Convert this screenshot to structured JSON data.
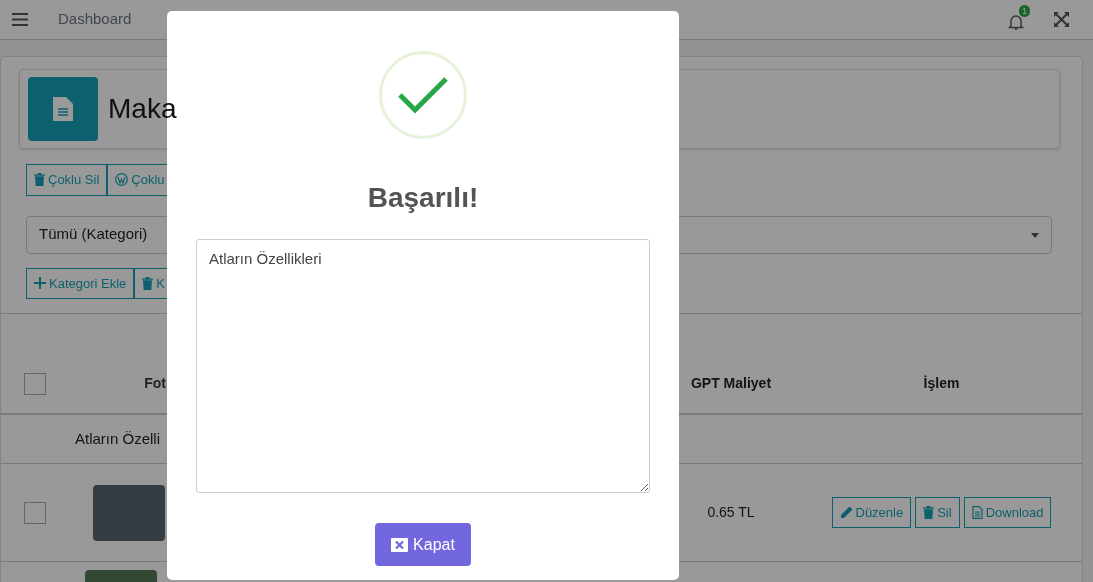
{
  "navbar": {
    "links": [
      {
        "label": "Dashboard"
      }
    ],
    "notification_count": "1"
  },
  "page_header": {
    "title": "Maka"
  },
  "bulk_actions": [
    {
      "label": "Çoklu Sil",
      "kind": "trash"
    },
    {
      "label": "Çoklu",
      "kind": "wordpress"
    }
  ],
  "category_select": {
    "value": "Tümü (Kategori)"
  },
  "category_actions": [
    {
      "label": "Kategori Ekle",
      "kind": "plus"
    },
    {
      "label": "K",
      "kind": "trash"
    }
  ],
  "table": {
    "header_checked": false,
    "columns": [
      "Fot",
      "GPT Maliyet",
      "İşlem"
    ],
    "group_row": "Atların Özelli",
    "rows": [
      {
        "checked": false,
        "cost": "0.65 TL",
        "actions": [
          {
            "label": "Düzenle",
            "kind": "edit"
          },
          {
            "label": "Sil",
            "kind": "trash"
          },
          {
            "label": "Download",
            "kind": "file"
          }
        ]
      }
    ]
  },
  "modal": {
    "title": "Başarılı!",
    "text": "Atların Özellikleri",
    "button": "Kapat"
  }
}
